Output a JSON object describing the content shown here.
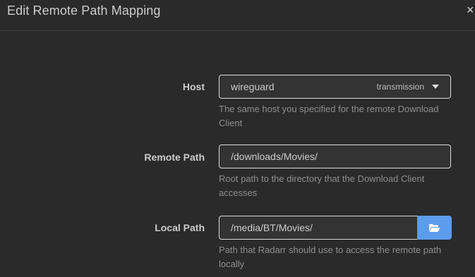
{
  "modal": {
    "title": "Edit Remote Path Mapping",
    "close": "×"
  },
  "form": {
    "host": {
      "label": "Host",
      "value": "wireguard",
      "hint": "transmission",
      "help": "The same host you specified for the remote Download Client"
    },
    "remote_path": {
      "label": "Remote Path",
      "value": "/downloads/Movies/",
      "help": "Root path to the directory that the Download Client accesses"
    },
    "local_path": {
      "label": "Local Path",
      "value": "/media/BT/Movies/",
      "help": "Path that Radarr should use to access the remote path locally"
    }
  },
  "colors": {
    "background": "#2a2a2a",
    "accent": "#5d9cec"
  },
  "icons": {
    "browse": "folder-open-icon",
    "dropdown": "caret-down-icon",
    "close": "close-icon"
  }
}
